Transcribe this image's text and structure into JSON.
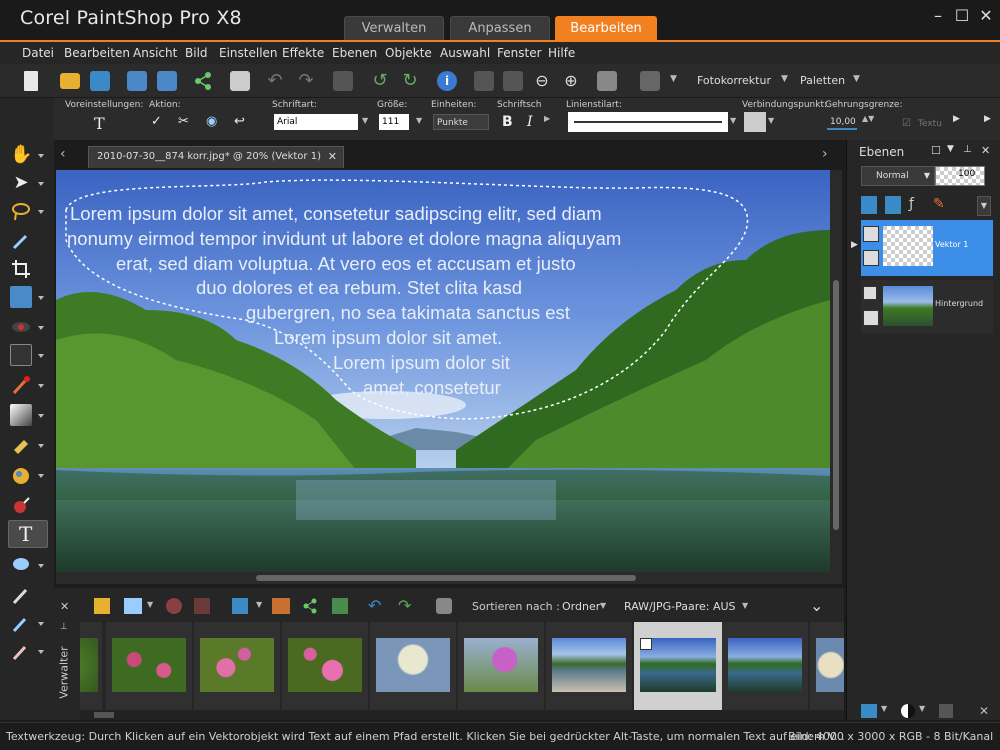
{
  "app": {
    "title": "Corel PaintShop Pro X8"
  },
  "workspace_tabs": [
    {
      "label": "Verwalten",
      "active": false
    },
    {
      "label": "Anpassen",
      "active": false
    },
    {
      "label": "Bearbeiten",
      "active": true
    }
  ],
  "menu": [
    "Datei",
    "Bearbeiten",
    "Ansicht",
    "Bild",
    "Einstellen",
    "Effekte",
    "Ebenen",
    "Objekte",
    "Auswahl",
    "Fenster",
    "Hilfe"
  ],
  "toolbar": {
    "fotokorrektur": "Fotokorrektur",
    "paletten": "Paletten"
  },
  "options": {
    "voreinstellungen": "Voreinstellungen:",
    "aktion": "Aktion:",
    "schriftart_label": "Schriftart:",
    "schriftart_value": "Arial",
    "groesse_label": "Größe:",
    "groesse_value": "111",
    "einheiten_label": "Einheiten:",
    "einheiten_value": "Punkte",
    "schriftsch_label": "Schriftsch",
    "bold": "B",
    "italic": "I",
    "linienstil_label": "Linienstilart:",
    "verbindung_label": "Verbindungspunkt:",
    "gehrung_label": "Gehrungsgrenze:",
    "gehrung_value": "10,00",
    "textu": "Textu"
  },
  "document": {
    "tab_label": "2010-07-30__874 korr.jpg* @  20% (Vektor 1)"
  },
  "canvas_text": [
    "Lorem ipsum dolor sit amet, consetetur sadipscing elitr, sed diam",
    "nonumy eirmod tempor invidunt ut labore et dolore magna aliquyam",
    "erat, sed diam voluptua. At vero eos et accusam et justo",
    "duo dolores et ea rebum. Stet clita kasd",
    "gubergren, no sea takimata sanctus est",
    "Lorem ipsum dolor sit amet.",
    "Lorem ipsum dolor sit",
    "amet, consetetur"
  ],
  "layers_panel": {
    "title": "Ebenen",
    "blend_mode": "Normal",
    "opacity": "100",
    "layers": [
      {
        "name": "Vektor 1",
        "selected": true
      },
      {
        "name": "Hintergrund",
        "selected": false
      }
    ]
  },
  "organizer": {
    "label": "Verwalter",
    "sort_label": "Sortieren nach :",
    "sort_value": "Ordner",
    "raw_label": "RAW/JPG-Paare: AUS"
  },
  "statusbar": {
    "hint": "Textwerkzeug: Durch Klicken auf ein Vektorobjekt wird Text auf einem Pfad erstellt. Klicken Sie bei gedrückter Alt-Taste, um normalen Text auf einem V...",
    "image_info": "Bild:  4000 x 3000 x RGB - 8 Bit/Kanal"
  },
  "colors": {
    "accent": "#f08020",
    "layer_selected": "#3d8ee8"
  }
}
